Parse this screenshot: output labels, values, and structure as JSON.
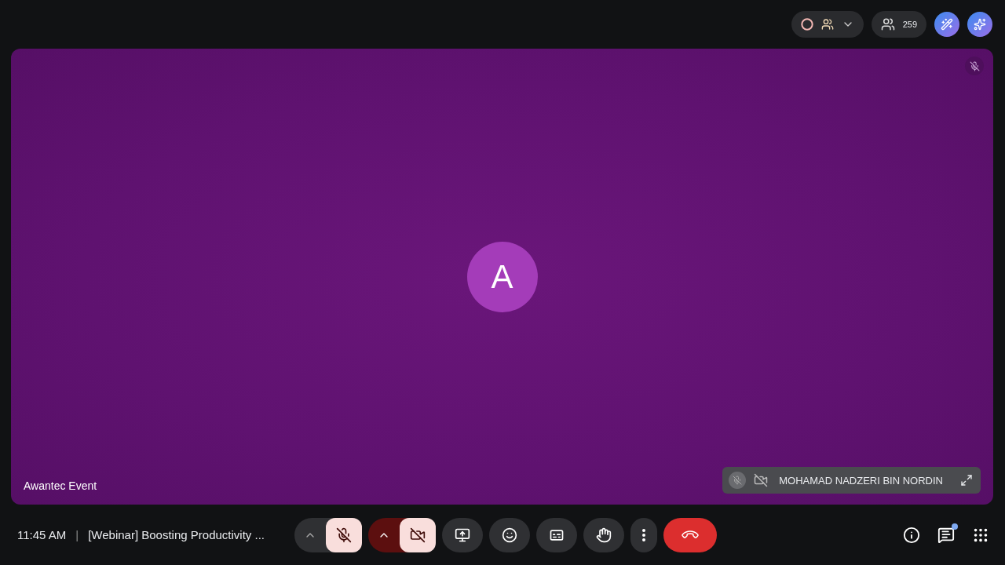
{
  "top_bar": {
    "participant_count": "259"
  },
  "main_tile": {
    "avatar_letter": "A",
    "name": "Awantec Event",
    "muted": true
  },
  "self_view": {
    "name": "MOHAMAD NADZERI BIN NORDIN",
    "muted": true,
    "camera_off": true
  },
  "meeting_info": {
    "time": "11:45 AM",
    "separator": "|",
    "title": "[Webinar] Boosting Productivity ..."
  },
  "controls": {
    "mic_muted": true,
    "camera_off": true
  },
  "chat": {
    "unread": true
  }
}
